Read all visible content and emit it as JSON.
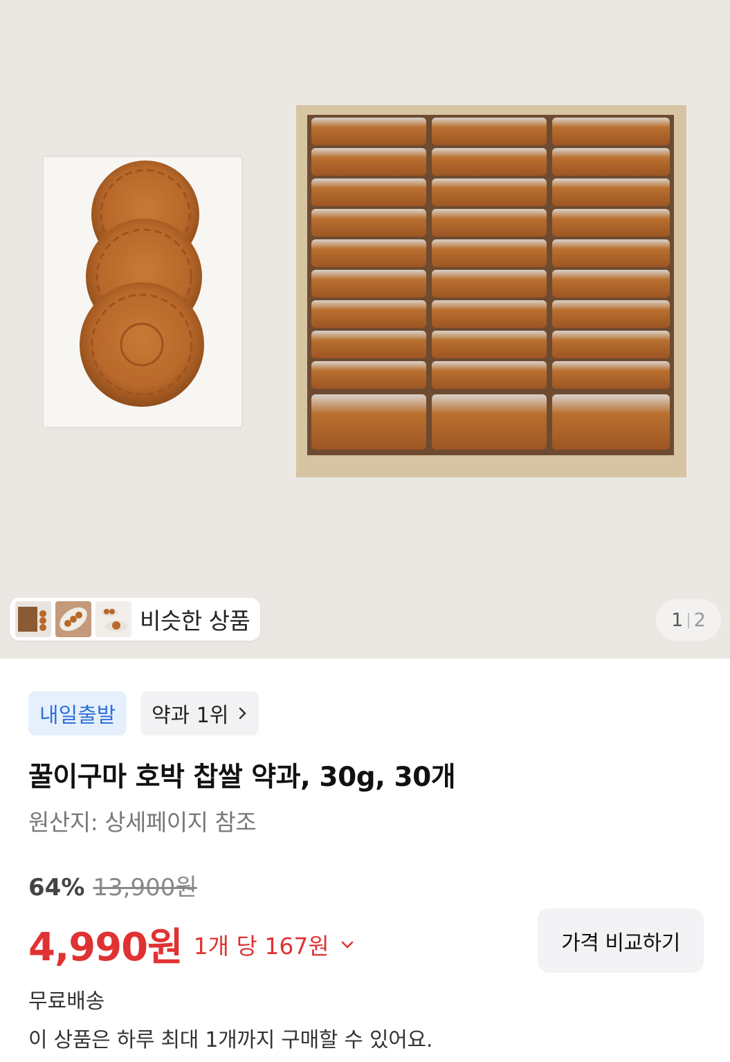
{
  "gallery": {
    "similar_label": "비슷한 상품",
    "counter_current": "1",
    "counter_separator": "|",
    "counter_total": "2"
  },
  "badges": {
    "delivery": "내일출발",
    "rank": "약과 1위"
  },
  "product": {
    "title": "꿀이구마 호박 찹쌀 약과, 30g, 30개",
    "origin": "원산지: 상세페이지 참조",
    "discount": "64%",
    "original_price": "13,900원",
    "price": "4,990원",
    "unit_price": "1개 당 167원",
    "compare_label": "가격 비교하기",
    "shipping": "무료배송",
    "purchase_limit": "이 상품은 하루 최대 1개까지 구매할 수 있어요."
  },
  "colors": {
    "price_red": "#e03232",
    "badge_blue": "#2f6fd6",
    "badge_blue_bg": "#e6f0fd"
  }
}
